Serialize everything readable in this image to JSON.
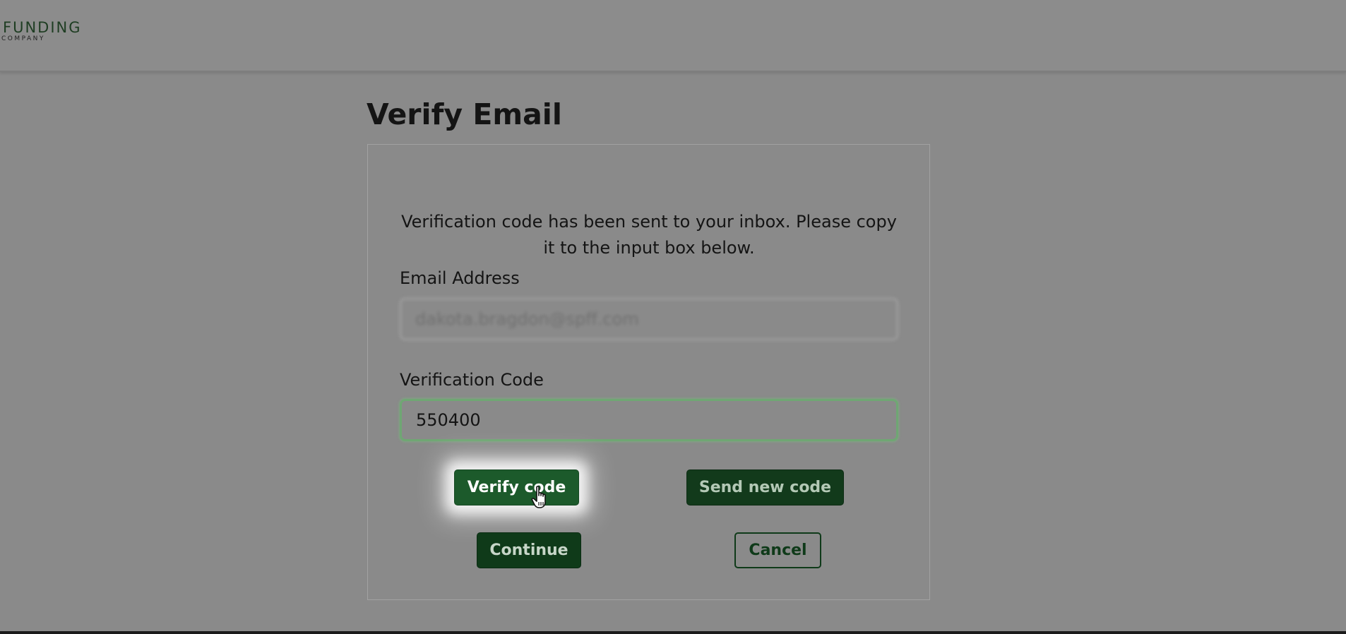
{
  "header": {
    "logo_main": "FUNDING",
    "logo_sub": "COMPANY"
  },
  "page": {
    "title": "Verify Email"
  },
  "form": {
    "message": "Verification code has been sent to your inbox. Please copy it to the input box below.",
    "email_label": "Email Address",
    "email_value": "dakota.bragdon@spff.com",
    "email_value_obscured": true,
    "code_label": "Verification Code",
    "code_value": "550400"
  },
  "actions": {
    "verify_label": "Verify code",
    "send_new_label": "Send new code",
    "continue_label": "Continue",
    "cancel_label": "Cancel"
  },
  "colors": {
    "background": "#8a8a8a",
    "primary_green": "#1c5a2b",
    "dark_green": "#0f3a19",
    "focus_border": "#6fa773"
  },
  "icons": {
    "cursor": "hand-pointer-icon"
  }
}
